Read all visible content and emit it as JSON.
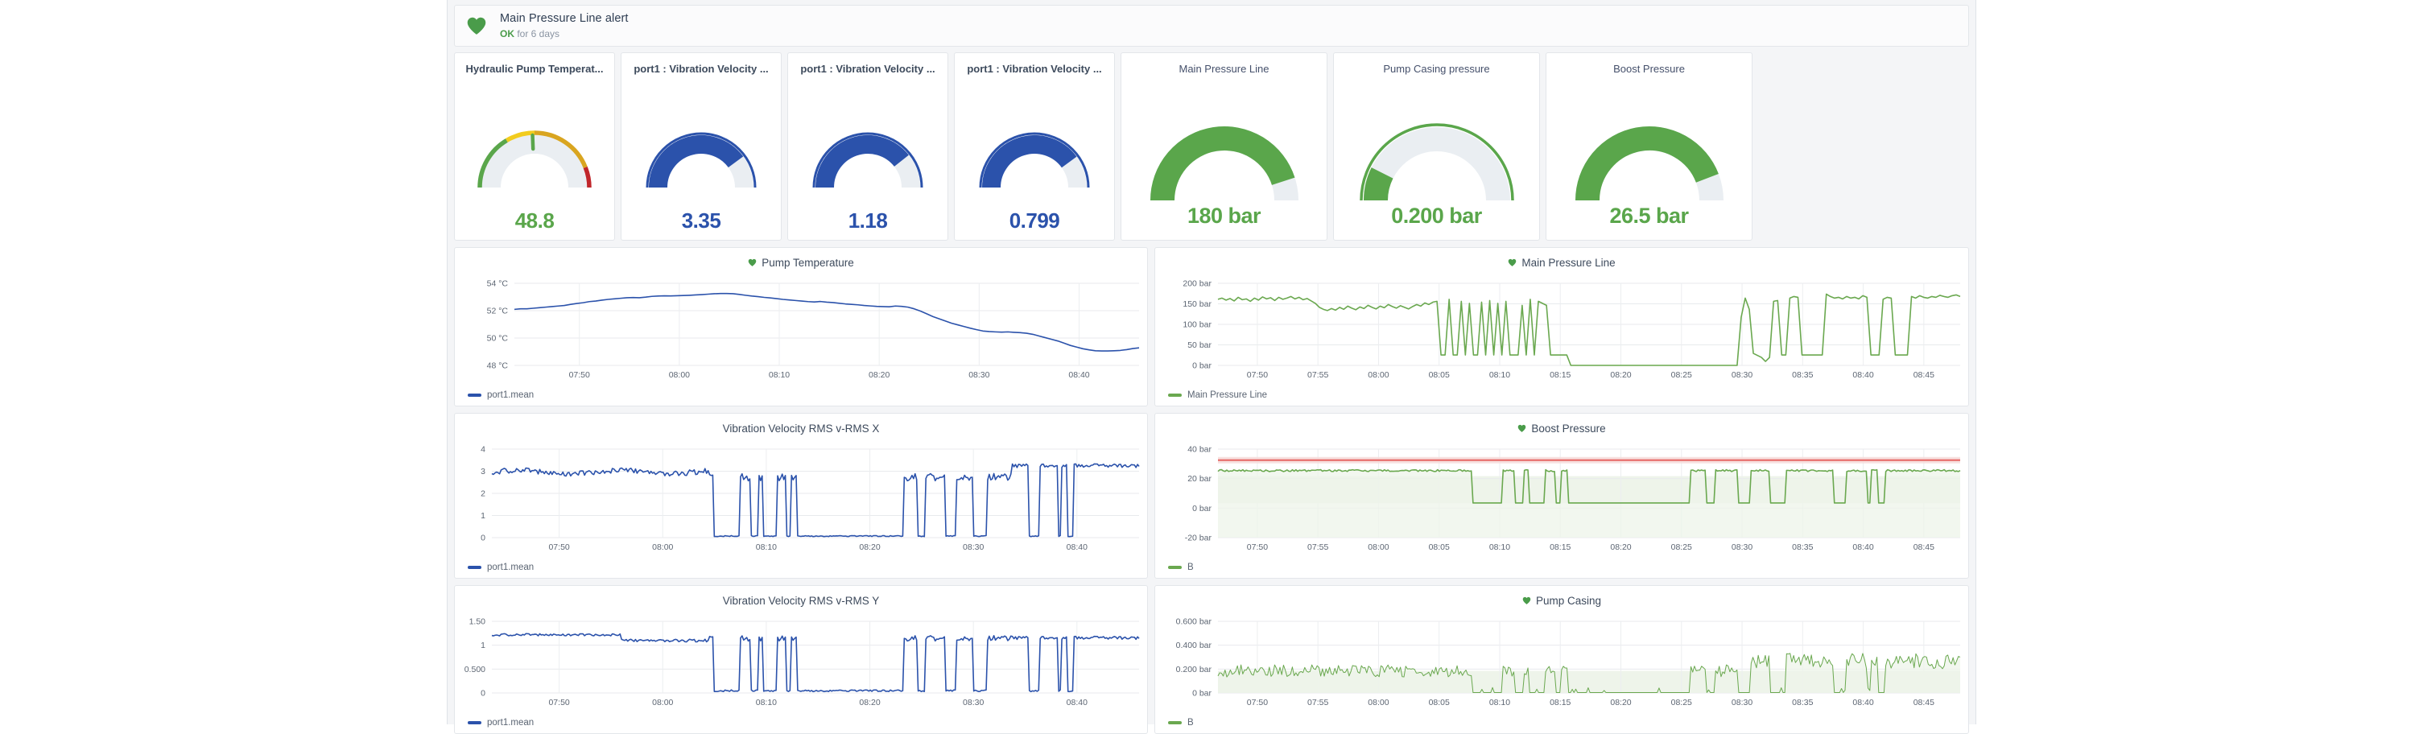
{
  "alert": {
    "icon": "heart-icon",
    "title": "Main Pressure Line alert",
    "status": "OK",
    "status_detail": " for 6 days"
  },
  "colors": {
    "green": "#5aa64b",
    "blue": "#2b52ab",
    "track": "#eaeef2",
    "yellow": "#f2cc1e",
    "orange": "#d9a520",
    "red": "#c0262b",
    "panel_border": "#e3e6ea",
    "page_bg": "#f4f5f7",
    "threshold_red": "#e8706e",
    "band_green": "#eef4ea"
  },
  "gauges": [
    {
      "title": "Hydraulic Pump Temperat...",
      "value_text": "48.8",
      "value": 48.8,
      "min": 0,
      "max": 100,
      "style": "segmented",
      "color": "#5aa64b",
      "size": "sm"
    },
    {
      "title": "port1 : Vibration Velocity ...",
      "value_text": "3.35",
      "value": 3.35,
      "min": 0,
      "max": 4.2,
      "style": "thick",
      "color": "#2b52ab",
      "size": "sm"
    },
    {
      "title": "port1 : Vibration Velocity ...",
      "value_text": "1.18",
      "value": 1.18,
      "min": 0,
      "max": 1.5,
      "style": "thick",
      "color": "#2b52ab",
      "size": "sm"
    },
    {
      "title": "port1 : Vibration Velocity ...",
      "value_text": "0.799",
      "value": 0.799,
      "min": 0,
      "max": 1.0,
      "style": "thick",
      "color": "#2b52ab",
      "size": "sm"
    },
    {
      "title": "Main Pressure Line",
      "value_text": "180 bar",
      "value": 180,
      "min": 0,
      "max": 200,
      "style": "thick",
      "color": "#5aa64b",
      "size": "lg"
    },
    {
      "title": "Pump Casing pressure",
      "value_text": "0.200 bar",
      "value": 0.2,
      "min": 0,
      "max": 1.35,
      "style": "ring",
      "color": "#5aa64b",
      "size": "lg"
    },
    {
      "title": "Boost Pressure",
      "value_text": "26.5 bar",
      "value": 26.5,
      "min": 0,
      "max": 30,
      "style": "thick",
      "color": "#5aa64b",
      "size": "lg"
    }
  ],
  "chart_data": [
    {
      "id": "pump-temperature",
      "type": "line",
      "title": "Pump Temperature",
      "has_heart": true,
      "color": "#2b52ab",
      "legend": "port1.mean",
      "ylabel": "",
      "yticks": [
        "48 °C",
        "50 °C",
        "52 °C",
        "54 °C"
      ],
      "ylim": [
        47.2,
        54.6
      ],
      "xticks": [
        "07:50",
        "08:00",
        "08:10",
        "08:20",
        "08:30",
        "08:40"
      ],
      "xtick_pos": [
        0.113,
        0.287,
        0.461,
        0.635,
        0.809,
        0.956
      ],
      "grid": true,
      "values": [
        52.25,
        52.3,
        52.3,
        52.35,
        52.4,
        52.45,
        52.5,
        52.55,
        52.6,
        52.7,
        52.78,
        52.85,
        52.95,
        53.0,
        53.08,
        53.15,
        53.2,
        53.25,
        53.3,
        53.32,
        53.3,
        53.35,
        53.42,
        53.45,
        53.47,
        53.46,
        53.48,
        53.5,
        53.52,
        53.55,
        53.58,
        53.62,
        53.66,
        53.68,
        53.68,
        53.66,
        53.6,
        53.52,
        53.45,
        53.4,
        53.33,
        53.28,
        53.22,
        53.15,
        53.1,
        53.05,
        53.0,
        52.95,
        52.92,
        52.96,
        52.9,
        52.86,
        52.8,
        52.74,
        52.7,
        52.66,
        52.6,
        52.56,
        52.52,
        52.5,
        52.48,
        52.55,
        52.52,
        52.45,
        52.3,
        52.1,
        51.85,
        51.6,
        51.4,
        51.2,
        51.0,
        50.85,
        50.7,
        50.55,
        50.42,
        50.3,
        50.25,
        50.22,
        50.2,
        50.22,
        50.18,
        50.15,
        50.1,
        50.0,
        49.85,
        49.7,
        49.55,
        49.4,
        49.2,
        49.0,
        48.85,
        48.7,
        48.6,
        48.52,
        48.5,
        48.5,
        48.52,
        48.55,
        48.62,
        48.72,
        48.78
      ]
    },
    {
      "id": "main-pressure-line",
      "type": "line",
      "title": "Main Pressure Line",
      "has_heart": true,
      "color": "#6aa84f",
      "legend": "Main Pressure Line",
      "yticks": [
        "0 bar",
        "50 bar",
        "100 bar",
        "150 bar",
        "200 bar"
      ],
      "ylim": [
        0,
        205
      ],
      "xticks": [
        "07:50",
        "07:55",
        "08:00",
        "08:05",
        "08:10",
        "08:15",
        "08:20",
        "08:25",
        "08:30",
        "08:35",
        "08:40",
        "08:45"
      ],
      "grid": true,
      "note": "stable ~160 bar then cycling between ~25 and ~170 with a zero period 08:14-08:24",
      "values": [
        165,
        168,
        163,
        167,
        161,
        170,
        164,
        166,
        160,
        168,
        163,
        171,
        166,
        169,
        162,
        170,
        165,
        168,
        172,
        166,
        170,
        164,
        167,
        161,
        155,
        145,
        140,
        137,
        142,
        138,
        145,
        140,
        148,
        143,
        139,
        146,
        142,
        150,
        145,
        141,
        148,
        144,
        152,
        147,
        143,
        149,
        145,
        141,
        147,
        152,
        148,
        156,
        152,
        158,
        160,
        26,
        26,
        165,
        26,
        26,
        160,
        26,
        155,
        26,
        26,
        158,
        26,
        162,
        26,
        155,
        26,
        160,
        26,
        26,
        26,
        150,
        26,
        165,
        26,
        160,
        155,
        150,
        26,
        26,
        26,
        26,
        26,
        0,
        0,
        0,
        0,
        0,
        0,
        0,
        0,
        0,
        0,
        0,
        0,
        0,
        0,
        0,
        0,
        0,
        0,
        0,
        0,
        0,
        0,
        0,
        0,
        0,
        0,
        0,
        0,
        0,
        0,
        0,
        0,
        0,
        0,
        0,
        0,
        0,
        0,
        0,
        0,
        0,
        0,
        120,
        168,
        140,
        30,
        25,
        20,
        10,
        20,
        160,
        162,
        26,
        26,
        168,
        172,
        170,
        26,
        26,
        26,
        26,
        26,
        26,
        178,
        172,
        168,
        170,
        166,
        172,
        168,
        170,
        166,
        174,
        170,
        26,
        26,
        26,
        165,
        170,
        168,
        26,
        26,
        26,
        26,
        172,
        168,
        174,
        170,
        168,
        172,
        170,
        175,
        172,
        170,
        174,
        176,
        172
      ]
    },
    {
      "id": "vibration-velocity-rms-x",
      "type": "line",
      "title": "Vibration Velocity RMS v-RMS X",
      "has_heart": false,
      "color": "#2b52ab",
      "legend": "port1.mean",
      "yticks": [
        "0",
        "1",
        "2",
        "3",
        "4"
      ],
      "ylim": [
        0,
        4.25
      ],
      "xticks": [
        "07:50",
        "08:00",
        "08:10",
        "08:20",
        "08:30",
        "08:40"
      ],
      "grid": true,
      "note": "baseline ~3.1-3.4 with dropout bursts to 0 between 08:06-08:14 and 08:14-08:24 flat zero"
    },
    {
      "id": "boost-pressure",
      "type": "line",
      "title": "Boost Pressure",
      "has_heart": true,
      "color": "#6aa84f",
      "legend": "B",
      "yticks": [
        "-20 bar",
        "0 bar",
        "20 bar",
        "40 bar"
      ],
      "ylim": [
        -28,
        44
      ],
      "xticks": [
        "07:50",
        "07:55",
        "08:00",
        "08:05",
        "08:10",
        "08:15",
        "08:20",
        "08:25",
        "08:30",
        "08:35",
        "08:40",
        "08:45"
      ],
      "grid": true,
      "threshold_line": 35,
      "band_low": 0,
      "band_high": 22,
      "note": "noisy ~26.5 bar, drops to 0 from 08:14 to 08:24, brief recovery spike at 08:25"
    },
    {
      "id": "vibration-velocity-rms-y",
      "type": "line",
      "title": "Vibration Velocity RMS v-RMS Y",
      "has_heart": false,
      "color": "#2b52ab",
      "legend": "port1.mean",
      "yticks": [
        "0",
        "0.500",
        "1",
        "1.50"
      ],
      "ylim": [
        0,
        1.6
      ],
      "xticks": [
        "07:50",
        "08:00",
        "08:10",
        "08:20",
        "08:30",
        "08:40"
      ],
      "grid": true,
      "note": "baseline ~1.15-1.35 with dropouts to 0, flat zero 08:14-08:24"
    },
    {
      "id": "pump-casing",
      "type": "line",
      "title": "Pump Casing",
      "has_heart": true,
      "color": "#6aa84f",
      "legend": "B",
      "yticks": [
        "0 bar",
        "0.200 bar",
        "0.400 bar",
        "0.600 bar"
      ],
      "ylim": [
        0,
        0.65
      ],
      "xticks": [
        "07:50",
        "07:55",
        "08:00",
        "08:05",
        "08:10",
        "08:15",
        "08:20",
        "08:25",
        "08:30",
        "08:35",
        "08:40",
        "08:45"
      ],
      "grid": true,
      "band_low": 0,
      "band_high": 0.2,
      "note": "dense noise around 0.18-0.30 bar, zero from 08:14 to 08:24, higher noise 0.25-0.45 after 08:27"
    }
  ]
}
